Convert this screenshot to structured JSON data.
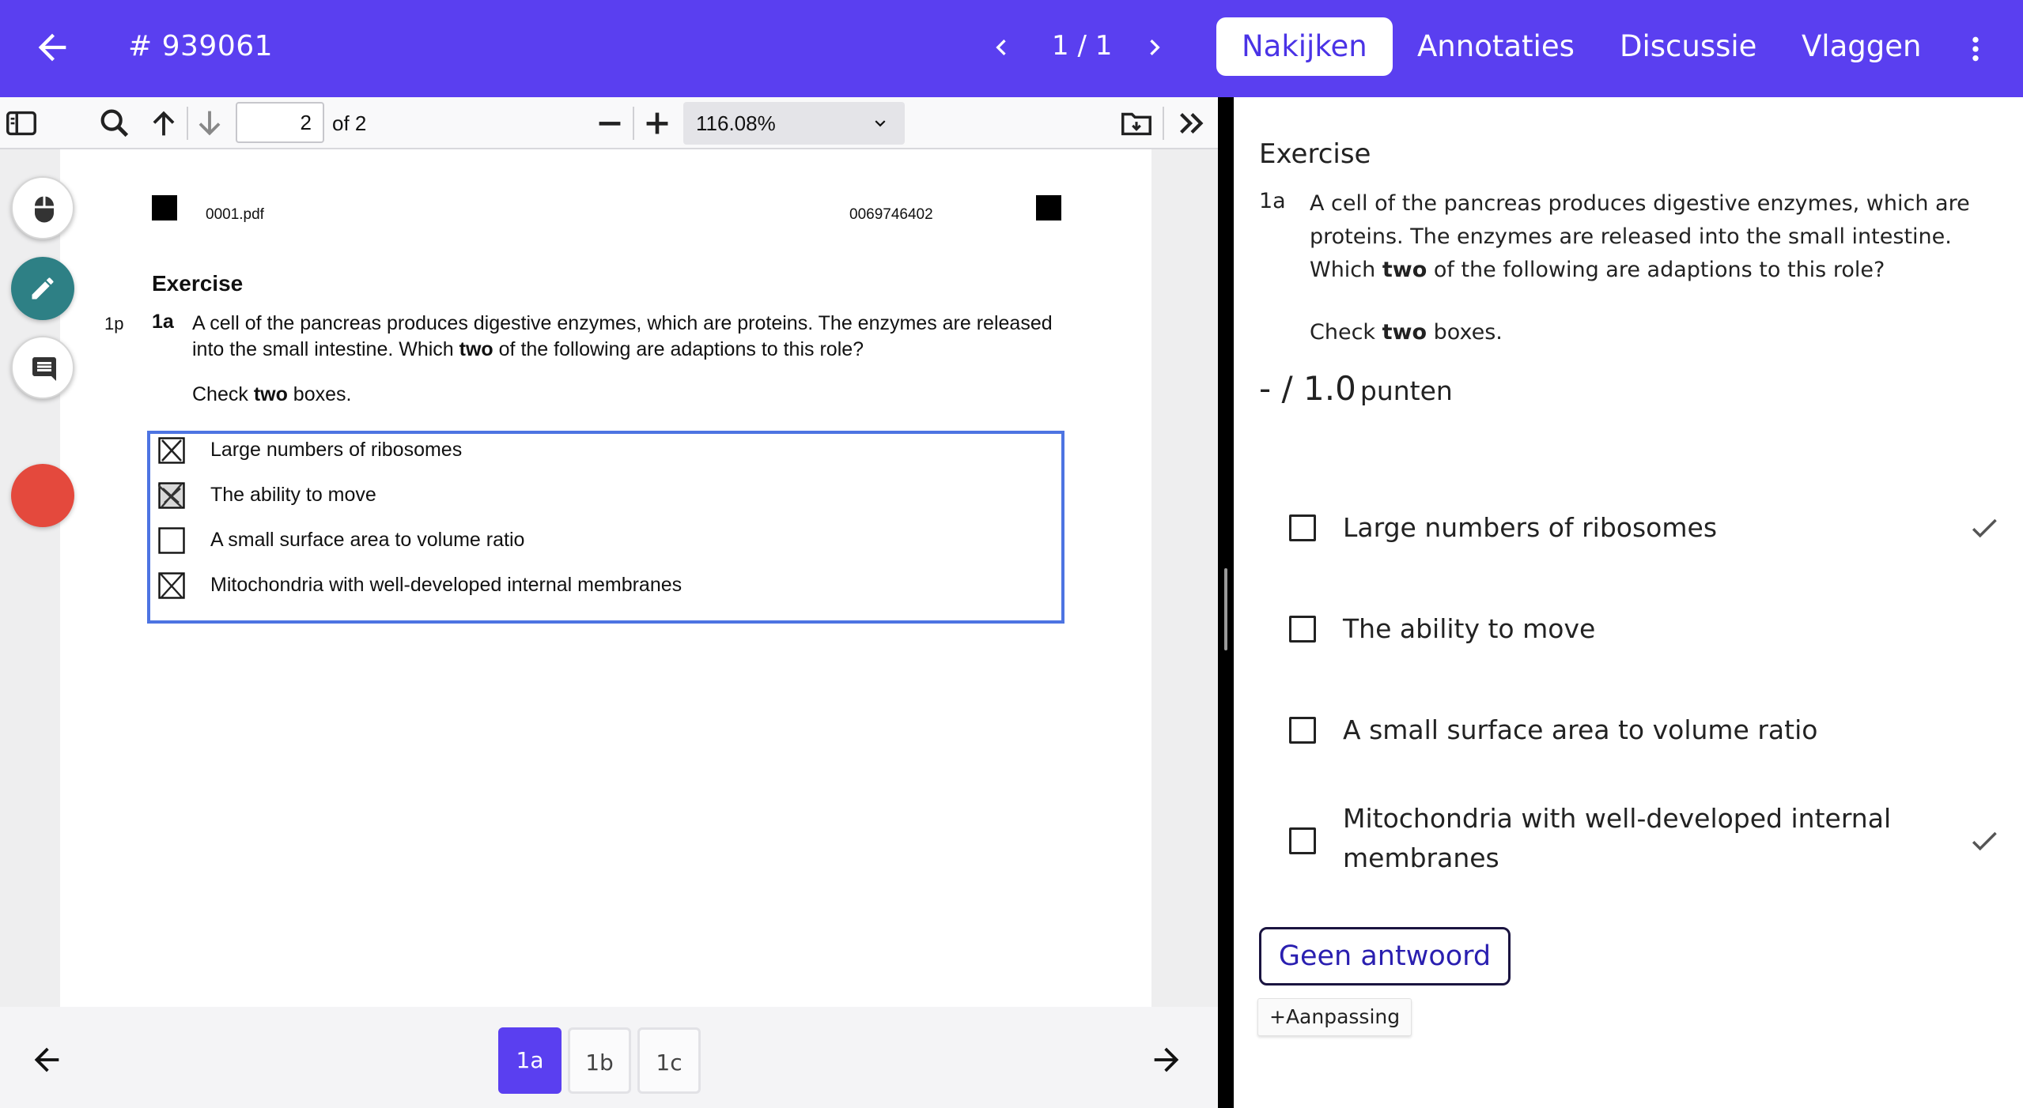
{
  "topbar": {
    "submission_id": "# 939061",
    "pager": "1 / 1",
    "tabs": [
      "Nakijken",
      "Annotaties",
      "Discussie",
      "Vlaggen"
    ],
    "active_tab": "Nakijken",
    "color": "#5a3ff0"
  },
  "pdf_toolbar": {
    "page_value": "2",
    "page_total": "of 2",
    "zoom": "116.08%"
  },
  "pdf_page": {
    "file_name": "0001.pdf",
    "code": "0069746402",
    "exercise_title": "Exercise",
    "points": "1p",
    "question_number": "1a",
    "question_text_1": "A cell of the pancreas produces digestive enzymes, which are proteins. The enzymes are released into the small intestine. Which ",
    "question_text_bold": "two",
    "question_text_2": " of the following are adaptions to this role?",
    "check_pre": "Check ",
    "check_bold": "two",
    "check_post": " boxes.",
    "options": [
      {
        "label": "Large numbers of ribosomes",
        "mark": "crossed"
      },
      {
        "label": "The ability to move",
        "mark": "crossed-scribbled"
      },
      {
        "label": "A small surface area to volume ratio",
        "mark": "empty"
      },
      {
        "label": "Mitochondria with well-developed internal membranes",
        "mark": "crossed"
      }
    ]
  },
  "bottom_nav": {
    "questions": [
      "1a",
      "1b",
      "1c"
    ],
    "active": "1a"
  },
  "grading": {
    "exercise_title": "Exercise",
    "question_number": "1a",
    "question_text_1": "A cell of the pancreas produces digestive enzymes, which are proteins. The enzymes are released into the small intestine. Which ",
    "question_text_bold": "two",
    "question_text_2": " of the following are adaptions to this role?",
    "check_pre": "Check ",
    "check_bold": "two",
    "check_post": " boxes.",
    "score": "- / 1.0",
    "score_unit": "punten",
    "options": [
      {
        "label": "Large numbers of ribosomes",
        "correct": true
      },
      {
        "label": "The ability to move",
        "correct": false
      },
      {
        "label": "A small surface area to volume ratio",
        "correct": false
      },
      {
        "label": "Mitochondria with well-developed internal membranes",
        "correct": true
      }
    ],
    "no_answer_button": "Geen antwoord",
    "adjust_button": "+Aanpassing"
  }
}
